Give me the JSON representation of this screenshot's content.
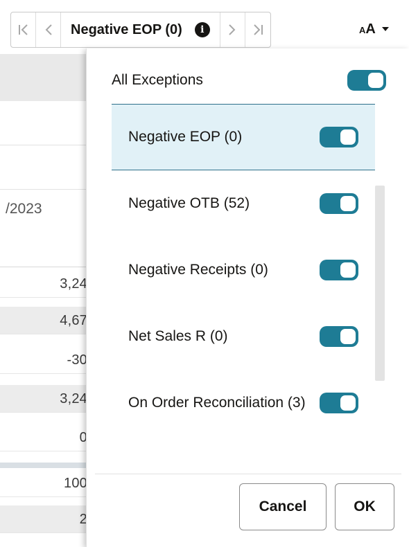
{
  "toolbar": {
    "first_icon": "first-page-icon",
    "prev_icon": "previous-icon",
    "title": "Negative EOP (0)",
    "info_icon": "info-icon",
    "info_glyph": "i",
    "next_icon": "next-icon",
    "last_icon": "last-page-icon",
    "font_size_label": "A",
    "font_size_small": "A",
    "dropdown_icon": "caret-down-icon"
  },
  "background": {
    "date_text": "/2023",
    "cells": [
      "3,24",
      "4,67",
      "-30",
      "3,24",
      "0",
      "100",
      "2"
    ]
  },
  "popup": {
    "all_label": "All Exceptions",
    "all_enabled": true,
    "items": [
      {
        "label": "Negative EOP (0)",
        "enabled": true,
        "selected": true
      },
      {
        "label": "Negative OTB (52)",
        "enabled": true,
        "selected": false
      },
      {
        "label": "Negative Receipts (0)",
        "enabled": true,
        "selected": false
      },
      {
        "label": "Net Sales R (0)",
        "enabled": true,
        "selected": false
      },
      {
        "label": "On Order Reconciliation (3)",
        "enabled": true,
        "selected": false
      }
    ],
    "cancel_label": "Cancel",
    "ok_label": "OK"
  },
  "colors": {
    "toggle_on": "#1e7c95",
    "selected_row": "#e1f1f7",
    "selected_border": "#2d6f8a"
  }
}
